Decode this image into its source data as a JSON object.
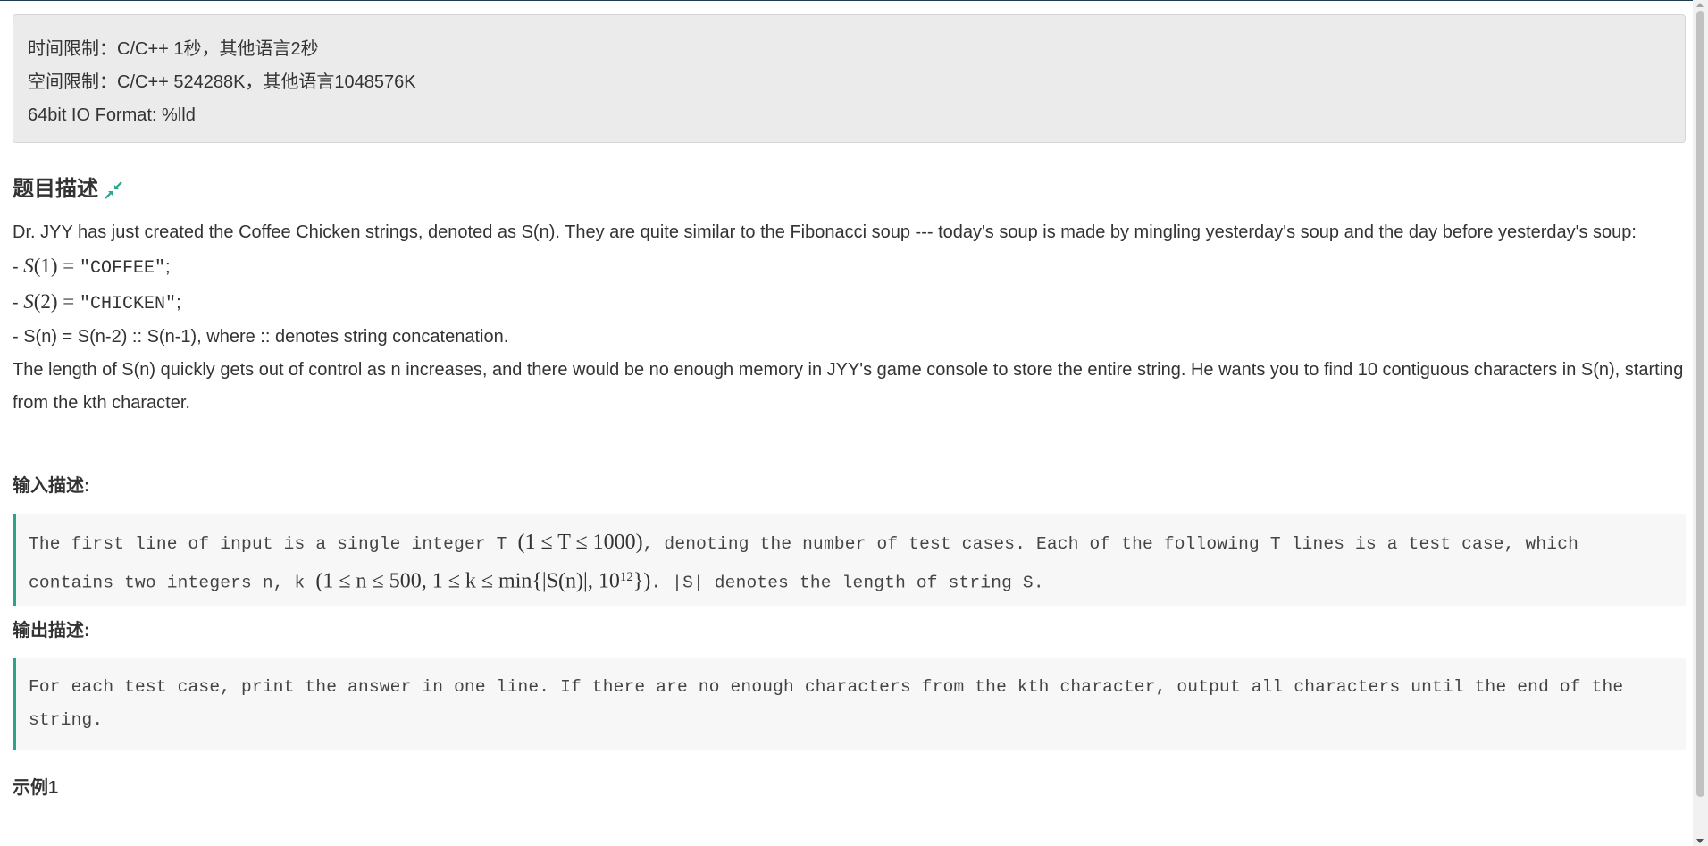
{
  "limits": {
    "time": "时间限制：C/C++ 1秒，其他语言2秒",
    "space": "空间限制：C/C++ 524288K，其他语言1048576K",
    "io_format": "64bit IO Format: %lld"
  },
  "description": {
    "title": "题目描述",
    "collapse_icon": "collapse-arrows-icon",
    "para1": "Dr. JYY has just created the Coffee Chicken strings, denoted as S(n). They are quite similar to the Fibonacci soup --- today's soup is made by mingling yesterday's soup and the day before yesterday's soup:",
    "line1_prefix": "- ",
    "line1_lhs": "S",
    "line1_arg": "(1)",
    "line1_eq": " = ",
    "line1_value": "\"COFFEE\"",
    "line1_end": ";",
    "line2_prefix": "- ",
    "line2_lhs": "S",
    "line2_arg": "(2)",
    "line2_eq": " = ",
    "line2_value": "\"CHICKEN\"",
    "line2_end": ";",
    "line3": "- S(n) = S(n-2) :: S(n-1), where :: denotes string concatenation.",
    "para2": "The length of S(n) quickly gets out of control as n increases, and there would be no enough memory in JYY's game console to store the entire string. He wants you to find 10 contiguous characters in S(n), starting from the kth character."
  },
  "input": {
    "title": "输入描述:",
    "t1": "The first line of input is a single integer T ",
    "m1": "(1 ≤ T ≤ 1000)",
    "t2": ", denoting the number of test cases. Each of the following T lines is a test case, which contains two integers n, k ",
    "m2a": "(1 ≤ n ≤ 500, 1 ≤ k ≤ min{|S(n)|, 10",
    "m2sup": "12",
    "m2b": "})",
    "t3": ". |S| denotes the length of string S."
  },
  "output": {
    "title": "输出描述:",
    "text": "For each test case, print the answer in one line. If there are no enough characters from the kth character, output all characters until the end of the string."
  },
  "example": {
    "title": "示例1"
  },
  "colors": {
    "accent": "#2ca48c",
    "box_bg": "#ebebeb",
    "code_bg": "#f7f7f7"
  }
}
